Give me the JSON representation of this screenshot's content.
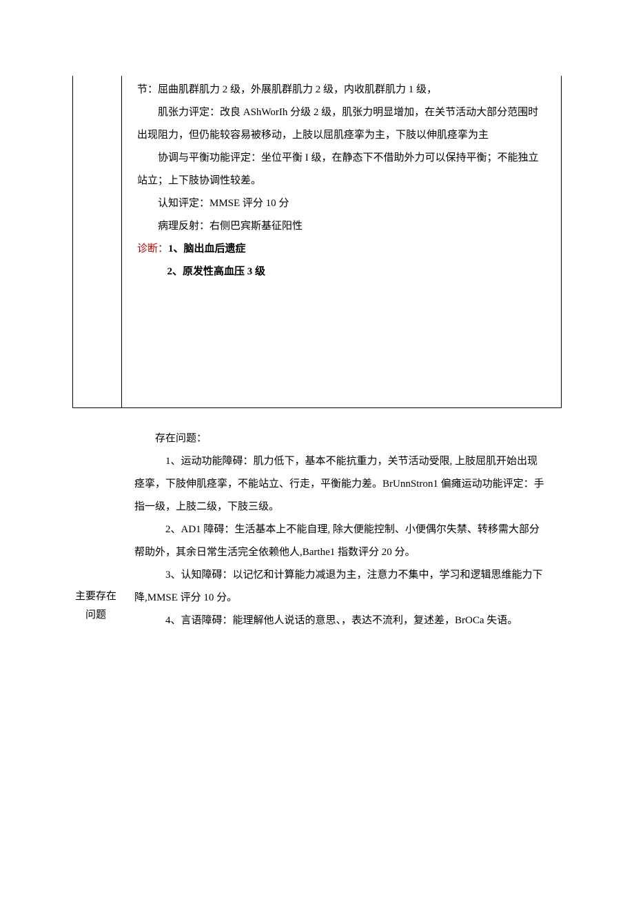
{
  "cell1": {
    "line1": "节：屈曲肌群肌力 2 级，外展肌群肌力 2 级，内收肌群肌力 1 级，",
    "line2": "肌张力评定：改良 AShWorIh 分级 2 级，肌张力明显增加，在关节活动大部分范围时出现阻力，但仍能较容易被移动，上肢以屈肌痉挛为主，下肢以伸肌痉挛为主",
    "line3": "协调与平衡功能评定：坐位平衡 I 级，在静态下不借助外力可以保持平衡；不能独立站立；上下肢协调性较差。",
    "line4": "认知评定：MMSE 评分 10 分",
    "line5": "病理反射：右侧巴宾斯基征阳性",
    "diag_label": "诊断：",
    "diag1": "1、脑出血后遗症",
    "diag2": "2、原发性高血压 3 级"
  },
  "section2": {
    "label_line1": "主要存在",
    "label_line2": "问题",
    "intro": "存在问题：",
    "p1": "1、运动功能障碍：肌力低下，基本不能抗重力，关节活动受限, 上肢屈肌开始出现痉挛，下肢伸肌痉挛，不能站立、行走，平衡能力差。BrUnnStron1 偏瘫运动功能评定：手指一级，上肢二级，下肢三级。",
    "p2": "2、AD1 障碍：生活基本上不能自理, 除大便能控制、小便偶尔失禁、转移需大部分帮助外，其余日常生活完全依赖他人,Barthe1 指数评分 20 分。",
    "p3": "3、认知障碍：以记忆和计算能力减退为主，注意力不集中，学习和逻辑思维能力下降,MMSE 评分 10 分。",
    "p4": "4、言语障碍：能理解他人说话的意思、，表达不流利，复述差，BrOCa 失语。"
  }
}
